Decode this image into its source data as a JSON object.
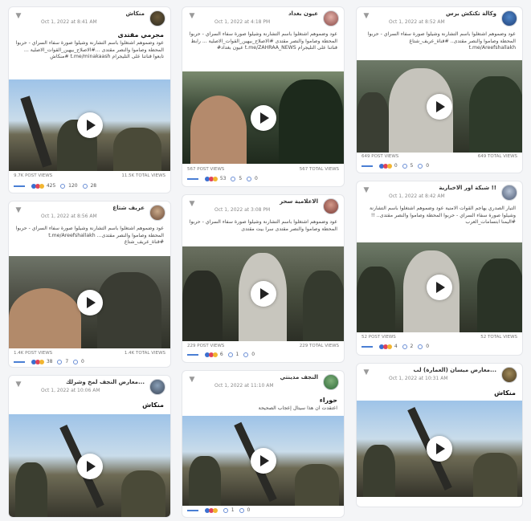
{
  "colors": {
    "accent": "#4a7fd4",
    "like": "#3b6fd0",
    "love": "#e0445a",
    "wow": "#f2b530"
  },
  "icons": {
    "menu": "chevron-down-icon",
    "play": "play-icon",
    "comment": "comment-icon",
    "share": "share-icon",
    "globe": "globe-icon"
  },
  "posts": [
    {
      "name": "منكاش",
      "date": "Oct 1, 2022 at 8:41 AM",
      "title": "مجرمي مقتدى",
      "text": "عود وضموهم اشتغلوا باسم التشارنة وشيلوا صورة سفاء السراي - حربوا المحطة وصاموا والنصر مقتدى ...#الاصلاح_بيهين_القوات_الاصلية ... تابعوا قناتنا على التليجرام t.me/minakaash #منكاش",
      "post_views": "9.7K POST VIEWS",
      "total_views": "11.5K TOTAL VIEWS",
      "reactions": "425",
      "comments": "120",
      "shares": "28"
    },
    {
      "name": "عيون بغداد",
      "date": "Oct 1, 2022 at 4:18 PM",
      "title": "",
      "text": "عود وضموهم اشتغلوا باسم التشارنة وشيلوا صورة سفاء السراي - حربوا المحطة وصاموا والنصر مقتدى #الاصلاح_بيهين_القوات_الاصلية ... رابط قناتنا على التليجرام t.me/ZAHRAA_NEWS عيون بغداد#",
      "post_views": "567 POST VIEWS",
      "total_views": "567 TOTAL VIEWS",
      "reactions": "53",
      "comments": "5",
      "shares": "0"
    },
    {
      "name": "وكالة تكتكش برس",
      "date": "Oct 1, 2022 at 8:52 AM",
      "title": "",
      "text": "عود وضموهم اشتغلوا باسم التشارنة وشيلوا صورة سفاء السراي - حربوا المحطة وصاموا والنصر مقتدى.. #قناة_عريف_شتاغ t.me/Areefshallakh",
      "post_views": "649 POST VIEWS",
      "total_views": "649 TOTAL VIEWS",
      "reactions": "0",
      "comments": "5",
      "shares": "0"
    },
    {
      "name": "عريف شتاغ",
      "date": "Oct 1, 2022 at 8:56 AM",
      "title": "",
      "text": "عود وضموهم اشتغلوا باسم التشارنة وشيلوا صورة سفاء السراي - حربوا المحطة وصاموا والنصر مقتدى... t.me/Areefshallakh #قناة_عريف_شتاغ",
      "post_views": "1.4K POST VIEWS",
      "total_views": "1.4K TOTAL VIEWS",
      "reactions": "38",
      "comments": "7",
      "shares": "0"
    },
    {
      "name": "الاعلامية سحر",
      "date": "Oct 1, 2022 at 3:08 PM",
      "title": "",
      "text": "عود وضموهم اشتغلوا باسم التشارنة وشيلوا صورة سفاء السراي - حربوا المحطة وصاموا والنصر مقتدى سرا بيت مقتدى",
      "post_views": "229 POST VIEWS",
      "total_views": "229 TOTAL VIEWS",
      "reactions": "6",
      "comments": "1",
      "shares": "0"
    },
    {
      "name": "!! شبكة اور الاخبارية",
      "date": "Oct 1, 2022 at 8:42 AM",
      "title": "",
      "text": "التيار الصدري يهاجم القوات الامنية عود وضموهم اشتغلوا باسم التشارنة وشيلوا صورة سفاء السراي - حربوا المحطة وصاموا والنصر مقتدى.. !! #اليمنا ابتسامات_العرب",
      "post_views": "52 POST VIEWS",
      "total_views": "52 TOTAL VIEWS",
      "reactions": "4",
      "comments": "2",
      "shares": "0"
    },
    {
      "name": "...معارض النجف لمخ وشرلك",
      "date": "Oct 1, 2022 at 10:06 AM",
      "title": "منكاش",
      "text": "",
      "post_views": "",
      "total_views": "",
      "reactions": "",
      "comments": "",
      "shares": ""
    },
    {
      "name": "النجف مدينتي",
      "date": "Oct 1, 2022 at 11:10 AM",
      "title": "حوراء",
      "text": "اعتقدت أن هذا سيتال إعجاب الصحيحة",
      "post_views": "",
      "total_views": "",
      "reactions": "",
      "comments": "1",
      "shares": "0"
    },
    {
      "name": "...معارض ميسان (العمارة) لب",
      "date": "Oct 1, 2022 at 10:31 AM",
      "title": "منكاش",
      "text": "",
      "post_views": "",
      "total_views": "",
      "reactions": "",
      "comments": "",
      "shares": ""
    }
  ]
}
